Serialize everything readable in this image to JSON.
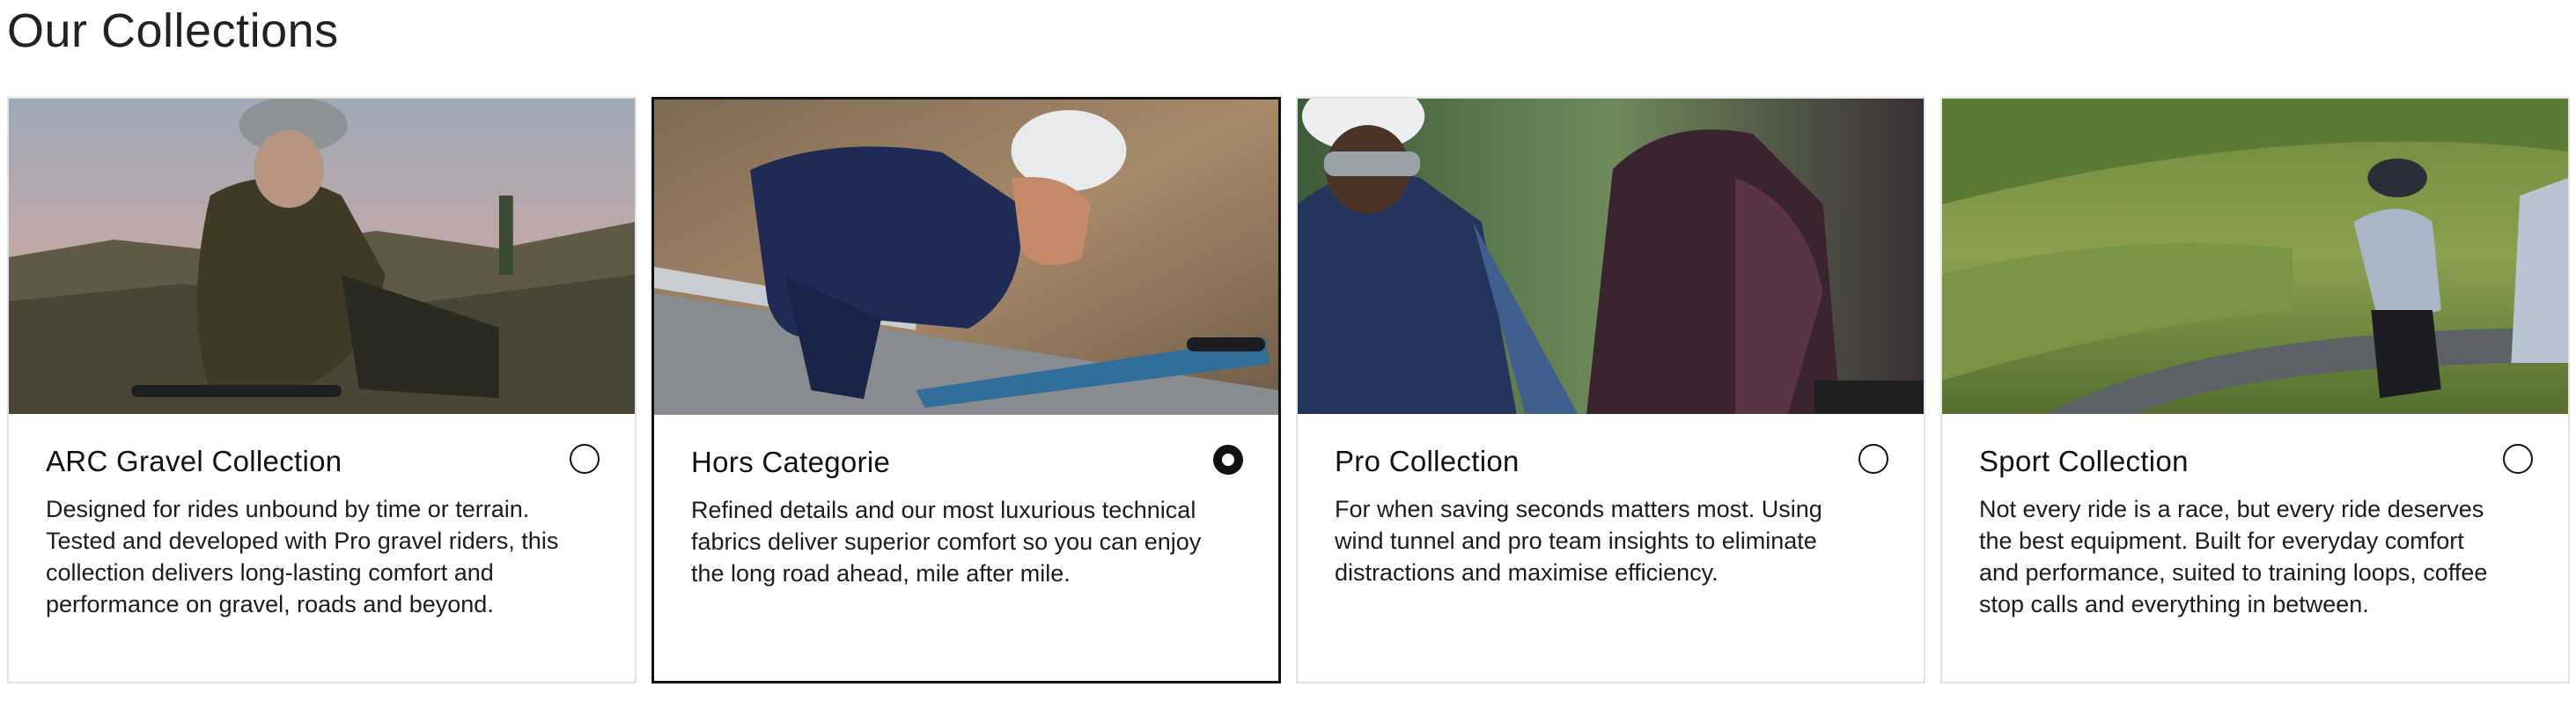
{
  "page": {
    "title": "Our Collections"
  },
  "collections": [
    {
      "title": "ARC Gravel Collection",
      "description": "Designed for rides unbound by time or terrain. Tested and developed with Pro gravel riders, this collection delivers long-lasting comfort and performance on gravel, roads and beyond.",
      "selected": false
    },
    {
      "title": "Hors Categorie",
      "description": "Refined details and our most luxurious technical fabrics deliver superior comfort so you can enjoy the long road ahead, mile after mile.",
      "selected": true
    },
    {
      "title": "Pro Collection",
      "description": "For when saving seconds matters most. Using wind tunnel and pro team insights to eliminate distractions and maximise efficiency.",
      "selected": false
    },
    {
      "title": "Sport Collection",
      "description": "Not every ride is a race, but every ride deserves the best equipment. Built for everyday comfort and performance, suited to training loops, coffee stop calls and everything in between.",
      "selected": false
    }
  ]
}
